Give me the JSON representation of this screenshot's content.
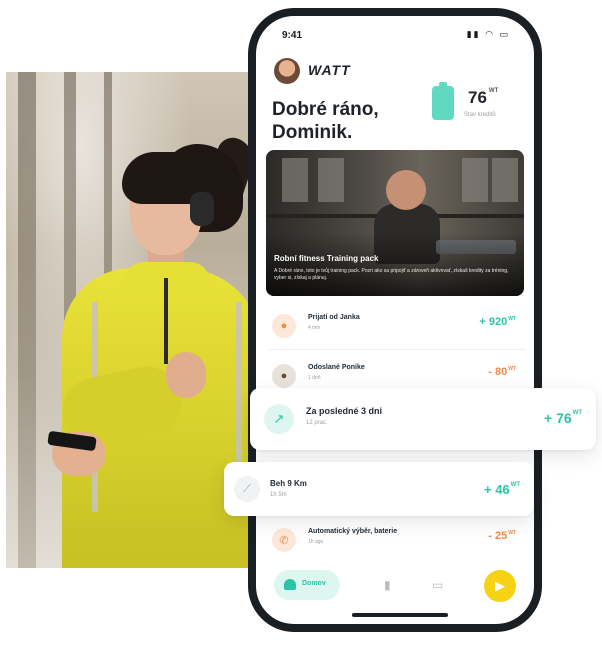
{
  "status_bar": {
    "time": "9:41",
    "icons": "▮▮ ◠ ▭"
  },
  "header": {
    "brand": "WATT",
    "greeting_line1": "Dobré ráno,",
    "greeting_line2": "Dominik.",
    "balance_value": "76",
    "balance_unit": "WT",
    "balance_label": "Stav kreditů"
  },
  "hero": {
    "title": "Robní fitness Training pack",
    "description": "A Dobré ráno, toto je tvůj training pack. Pozri ako sa pripojiť a zároveň aktivovať, získaš kredity za tréning, vyber si, získaj a plánuj."
  },
  "activities": [
    {
      "icon": "avatar-icon",
      "title": "Prijatí od Janka",
      "sub": "4 min",
      "value": "+ 920",
      "unit": "WT",
      "kind": "pos"
    },
    {
      "icon": "avatar-icon",
      "title": "Odoslané Ponike",
      "sub": "1 deň",
      "value": "- 80",
      "unit": "WT",
      "kind": "neg"
    },
    {
      "icon": "phone-icon",
      "title": "Automatický výběr, baterie",
      "sub": "1h ago",
      "value": "- 25",
      "unit": "WT",
      "kind": "neg"
    }
  ],
  "float_period": {
    "title": "Za posledné 3 dni",
    "sub": "12 prac.",
    "value": "+ 76",
    "unit": "WT"
  },
  "float_run": {
    "title": "Beh 9 Km",
    "sub": "1h 5m",
    "value": "+ 46",
    "unit": "WT"
  },
  "bottom_nav": {
    "home_label": "Domov"
  },
  "colors": {
    "accent": "#2bc4a6",
    "negative": "#f08a4b",
    "play": "#f5d214",
    "frame": "#1a1f24"
  }
}
